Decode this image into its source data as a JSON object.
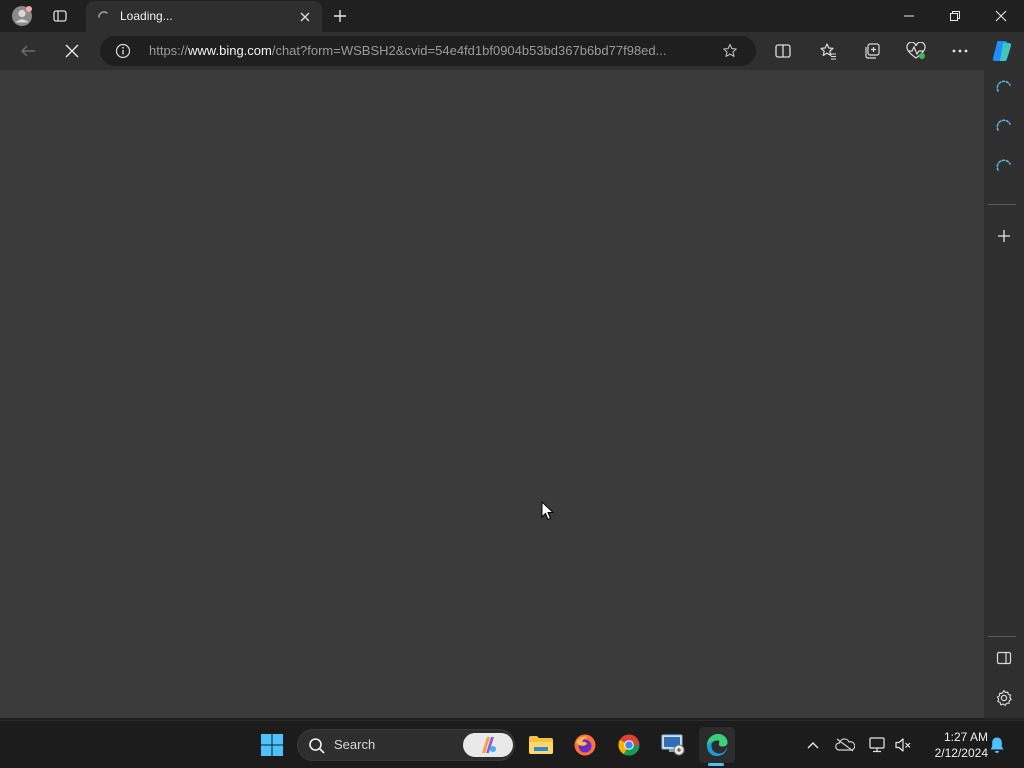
{
  "tab": {
    "title": "Loading..."
  },
  "address_bar": {
    "url_prefix": "https://",
    "url_domain": "www.bing.com",
    "url_path": "/chat?form=WSBSH2&cvid=54e4fd1bf0904b53bd367b6bd77f98ed..."
  },
  "taskbar": {
    "search_label": "Search",
    "clock_time": "1:27 AM",
    "clock_date": "2/12/2024"
  },
  "icons": {
    "titlebar": [
      "profile-avatar-icon",
      "tab-actions-icon",
      "loading-spinner-icon",
      "close-icon",
      "plus-icon",
      "minimize-icon",
      "restore-icon",
      "close-window-icon"
    ],
    "toolbar": [
      "back-arrow-icon",
      "stop-loading-icon",
      "info-icon",
      "star-icon",
      "split-screen-icon",
      "favorites-icon",
      "collections-icon",
      "performance-icon",
      "more-icon",
      "copilot-icon"
    ],
    "sidebar": [
      "loading-spinner-icon",
      "loading-spinner-icon",
      "loading-spinner-icon",
      "plus-icon",
      "sidebar-toggle-icon",
      "gear-icon"
    ],
    "taskbar": [
      "windows-start-icon",
      "search-icon",
      "file-explorer-icon",
      "firefox-icon",
      "chrome-icon",
      "remote-desktop-icon",
      "edge-icon",
      "chevron-up-icon",
      "onedrive-icon",
      "network-icon",
      "volume-muted-icon",
      "notification-bell-icon"
    ]
  },
  "colors": {
    "content_bg": "#3b3b3b",
    "chrome_bg": "#2f2f2f",
    "titlebar_bg": "#202020",
    "taskbar_bg": "#1c1c1c",
    "accent": "#4cc2ff"
  }
}
